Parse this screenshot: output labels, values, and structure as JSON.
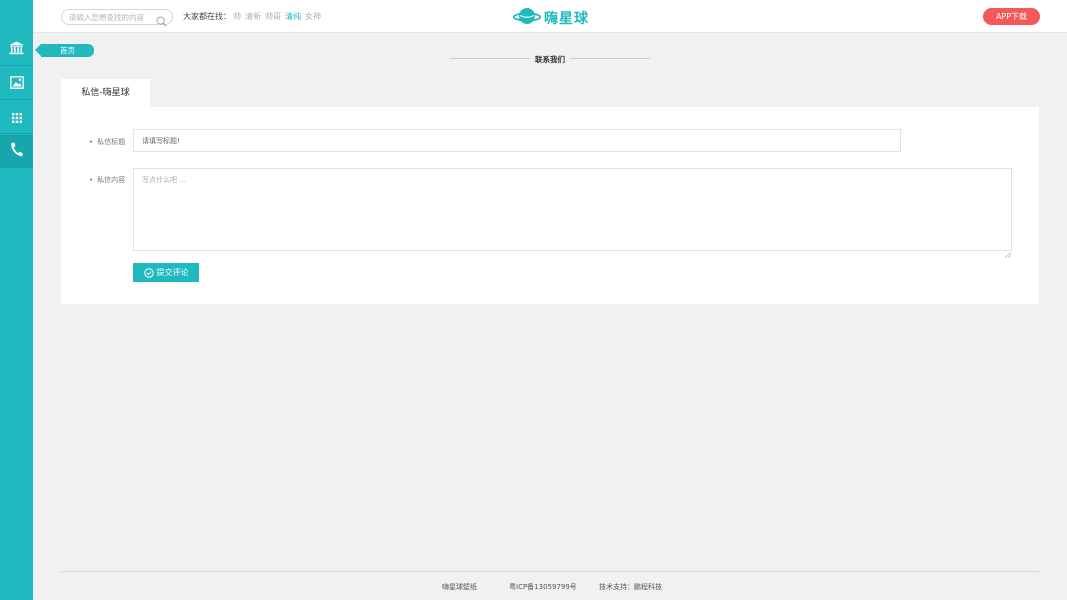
{
  "sidebar": {
    "items": [
      {
        "name": "museum-icon"
      },
      {
        "name": "image-icon"
      },
      {
        "name": "apps-grid-icon"
      },
      {
        "name": "phone-icon"
      }
    ],
    "active_index": 3,
    "color": "#1fb9bf"
  },
  "header": {
    "search": {
      "placeholder": "请输入您想查找的内容"
    },
    "hot_label": "大家都在找：",
    "hot_tags": [
      {
        "label": "帅",
        "active": false
      },
      {
        "label": "清新",
        "active": false
      },
      {
        "label": "帅哥",
        "active": false
      },
      {
        "label": "清纯",
        "active": true
      },
      {
        "label": "女神",
        "active": false
      }
    ],
    "logo_text": "嗨星球",
    "app_button": "APP下载"
  },
  "breadcrumb": {
    "home": "首页"
  },
  "section_title": "联系我们",
  "form": {
    "tab_label": "私信-嗨星球",
    "title_label": "私信标题",
    "title_placeholder": "请填写标题!",
    "content_label": "私信内容",
    "content_placeholder": "写点什么吧 ...",
    "submit_label": "提交评论"
  },
  "footer": {
    "site_name": "嗨星球壁纸",
    "icp": "粤ICP备13059799号",
    "support": "技术支持：鹏程科技"
  },
  "colors": {
    "accent": "#1fb9bf",
    "app_button": "#f25a5a",
    "required": "#e04646"
  }
}
